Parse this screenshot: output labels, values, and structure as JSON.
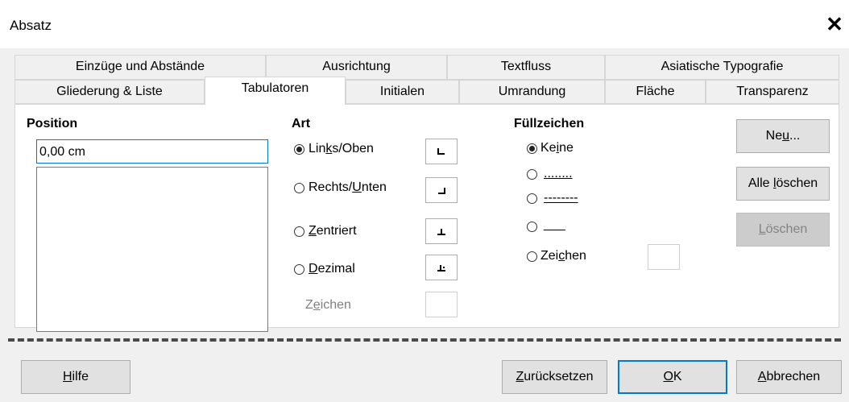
{
  "window": {
    "title": "Absatz",
    "close_icon": "close-icon"
  },
  "tabs": {
    "row1": [
      "Einzüge und Abstände",
      "Ausrichtung",
      "Textfluss",
      "Asiatische Typografie"
    ],
    "row2": [
      "Gliederung & Liste",
      "Tabulatoren",
      "Initialen",
      "Umrandung",
      "Fläche",
      "Transparenz"
    ],
    "active": "Tabulatoren"
  },
  "position": {
    "header": "Position",
    "value": "0,00 cm"
  },
  "art": {
    "header": "Art",
    "options": [
      {
        "pre": "Lin",
        "u": "k",
        "post": "s/Oben",
        "checked": true
      },
      {
        "pre": "Rechts/",
        "u": "U",
        "post": "nten",
        "checked": false
      },
      {
        "pre": "",
        "u": "Z",
        "post": "entriert",
        "checked": false
      },
      {
        "pre": "",
        "u": "D",
        "post": "ezimal",
        "checked": false
      }
    ],
    "zeichen": {
      "pre": "Z",
      "u": "e",
      "post": "ichen"
    }
  },
  "fuell": {
    "header": "Füllzeichen",
    "options": [
      {
        "pre": "Ke",
        "u": "i",
        "post": "ne",
        "checked": true
      },
      {
        "pre": "",
        "u": "........",
        "post": "",
        "checked": false
      },
      {
        "pre": "",
        "u": "--------",
        "post": "",
        "checked": false
      },
      {
        "pre": "",
        "u": "___",
        "post": "",
        "checked": false
      },
      {
        "pre": "Zei",
        "u": "c",
        "post": "hen",
        "checked": false
      }
    ]
  },
  "side_buttons": {
    "neu": {
      "pre": "Ne",
      "u": "u",
      "post": "..."
    },
    "alle": {
      "pre": "Alle ",
      "u": "l",
      "post": "öschen"
    },
    "loeschen": {
      "pre": "",
      "u": "L",
      "post": "öschen"
    }
  },
  "footer": {
    "hilfe": {
      "u": "H",
      "post": "ilfe"
    },
    "zuruecksetzen": {
      "u": "Z",
      "post": "urücksetzen"
    },
    "ok": {
      "u": "O",
      "post": "K"
    },
    "abbrechen": {
      "u": "A",
      "post": "bbrechen"
    }
  },
  "colors": {
    "accent": "#0078d7",
    "panel": "#ffffff",
    "bg": "#f0f0f0"
  }
}
